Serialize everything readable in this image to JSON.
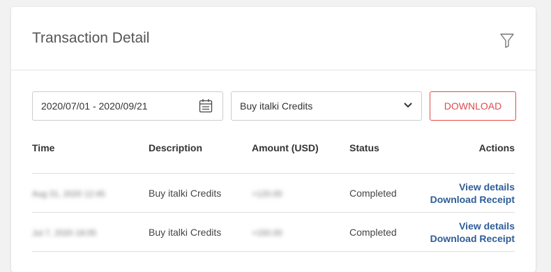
{
  "header": {
    "title": "Transaction Detail",
    "filter_icon": "filter-icon"
  },
  "filters": {
    "date_range": "2020/07/01 - 2020/09/21",
    "type_select": "Buy italki Credits",
    "download_label": "DOWNLOAD"
  },
  "table": {
    "columns": [
      "Time",
      "Description",
      "Amount (USD)",
      "Status",
      "Actions"
    ],
    "rows": [
      {
        "time": "Aug 31, 2020 12:45",
        "description": "Buy italki Credits",
        "amount": "+120.00",
        "status": "Completed",
        "action_details": "View details",
        "action_receipt": "Download Receipt"
      },
      {
        "time": "Jul 7, 2020 18:05",
        "description": "Buy italki Credits",
        "amount": "+150.00",
        "status": "Completed",
        "action_details": "View details",
        "action_receipt": "Download Receipt"
      }
    ]
  },
  "colors": {
    "accent_red": "#e04a4a",
    "link_blue": "#2e5d99"
  }
}
